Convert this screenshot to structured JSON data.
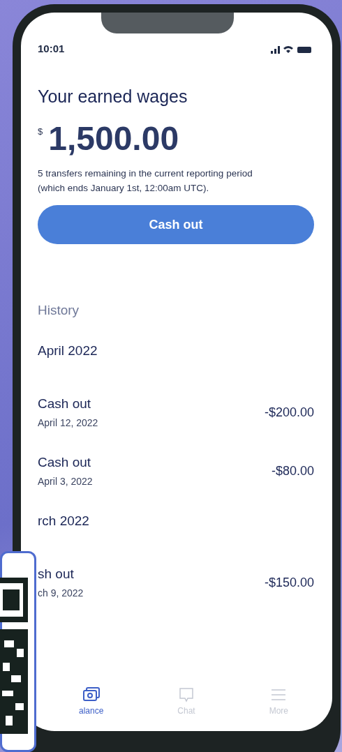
{
  "status_bar": {
    "time": "10:01"
  },
  "balance": {
    "title": "Your earned wages",
    "currency": "$",
    "amount": "1,500.00",
    "note": "5 transfers remaining in the current reporting period (which ends January 1st, 12:00am UTC).",
    "button": "Cash out"
  },
  "history": {
    "title": "History",
    "groups": [
      {
        "month": "April 2022",
        "items": [
          {
            "title": "Cash out",
            "date": "April 12, 2022",
            "amount": "-$200.00"
          },
          {
            "title": "Cash out",
            "date": "April 3, 2022",
            "amount": "-$80.00"
          }
        ]
      },
      {
        "month": "rch 2022",
        "items": [
          {
            "title": "sh out",
            "date": "ch 9, 2022",
            "amount": "-$150.00"
          }
        ]
      }
    ]
  },
  "tab_bar": [
    {
      "label": "alance",
      "kind": "balance",
      "selected": true
    },
    {
      "label": "Chat",
      "kind": "chat",
      "selected": false
    },
    {
      "label": "More",
      "kind": "more",
      "selected": false
    }
  ]
}
